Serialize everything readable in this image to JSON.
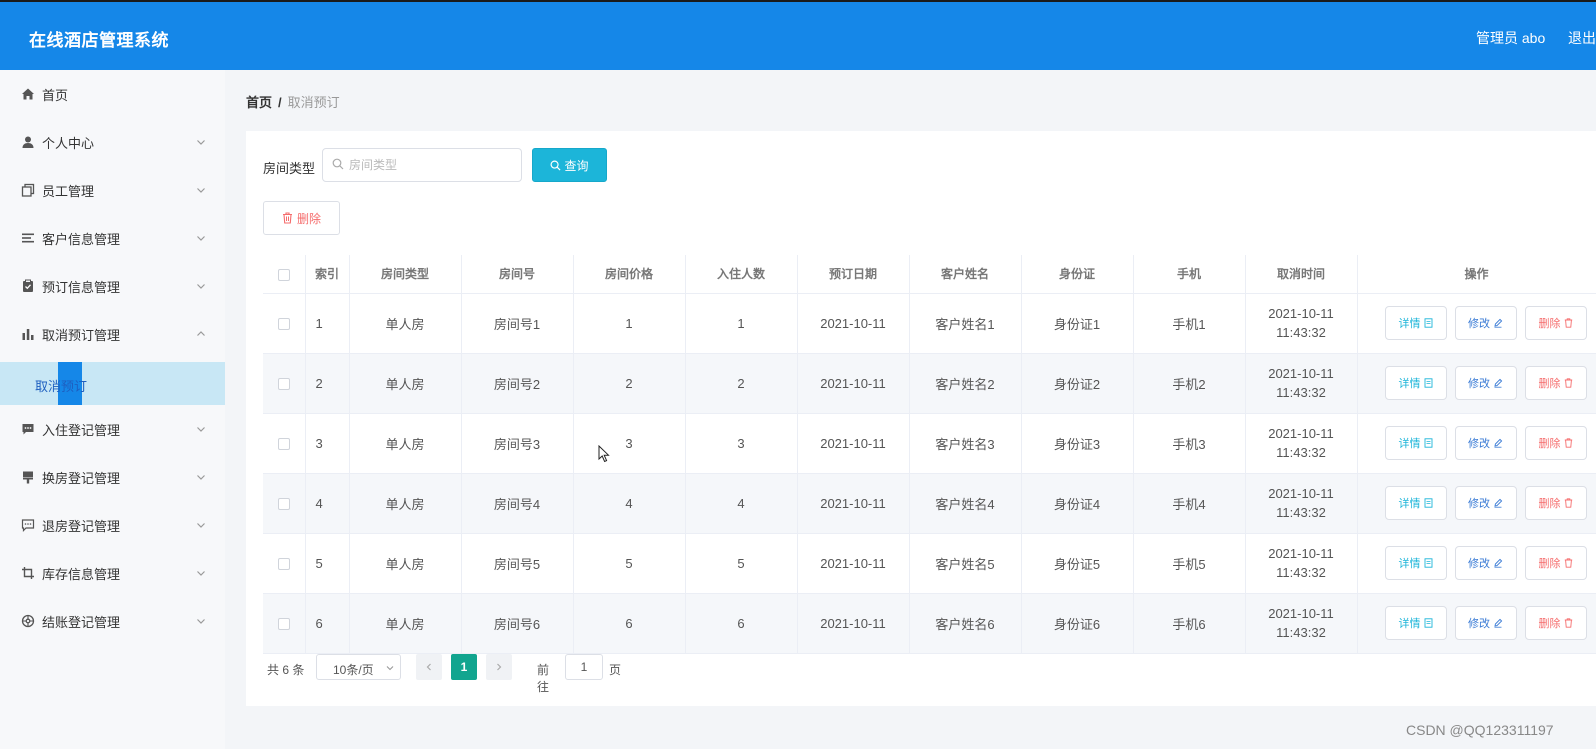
{
  "header": {
    "title": "在线酒店管理系统",
    "user": "管理员 abo",
    "logout": "退出"
  },
  "sidebar": {
    "items": [
      {
        "label": "首页",
        "icon": "home-icon"
      },
      {
        "label": "个人中心",
        "icon": "user-icon"
      },
      {
        "label": "员工管理",
        "icon": "copy-icon"
      },
      {
        "label": "客户信息管理",
        "icon": "list-icon"
      },
      {
        "label": "预订信息管理",
        "icon": "clipboard-icon"
      },
      {
        "label": "取消预订管理",
        "icon": "bar-chart-icon"
      },
      {
        "label": "入住登记管理",
        "icon": "message-icon"
      },
      {
        "label": "换房登记管理",
        "icon": "brush-icon"
      },
      {
        "label": "退房登记管理",
        "icon": "chat-icon"
      },
      {
        "label": "库存信息管理",
        "icon": "crop-icon"
      },
      {
        "label": "结账登记管理",
        "icon": "gear-icon"
      }
    ],
    "active_sub": "取消预订"
  },
  "breadcrumb": {
    "home": "首页",
    "separator": "/",
    "current": "取消预订"
  },
  "search": {
    "label": "房间类型",
    "placeholder": "房间类型",
    "value": "",
    "button": "查询"
  },
  "toolbar": {
    "delete": "删除"
  },
  "table": {
    "headers": [
      "索引",
      "房间类型",
      "房间号",
      "房间价格",
      "入住人数",
      "预订日期",
      "客户姓名",
      "身份证",
      "手机",
      "取消时间",
      "操作"
    ],
    "rows": [
      {
        "idx": "1",
        "type": "单人房",
        "room": "房间号1",
        "price": "1",
        "people": "1",
        "date": "2021-10-11",
        "name": "客户姓名1",
        "id": "身份证1",
        "phone": "手机1",
        "time": "2021-10-11 11:43:32"
      },
      {
        "idx": "2",
        "type": "单人房",
        "room": "房间号2",
        "price": "2",
        "people": "2",
        "date": "2021-10-11",
        "name": "客户姓名2",
        "id": "身份证2",
        "phone": "手机2",
        "time": "2021-10-11 11:43:32"
      },
      {
        "idx": "3",
        "type": "单人房",
        "room": "房间号3",
        "price": "3",
        "people": "3",
        "date": "2021-10-11",
        "name": "客户姓名3",
        "id": "身份证3",
        "phone": "手机3",
        "time": "2021-10-11 11:43:32"
      },
      {
        "idx": "4",
        "type": "单人房",
        "room": "房间号4",
        "price": "4",
        "people": "4",
        "date": "2021-10-11",
        "name": "客户姓名4",
        "id": "身份证4",
        "phone": "手机4",
        "time": "2021-10-11 11:43:32"
      },
      {
        "idx": "5",
        "type": "单人房",
        "room": "房间号5",
        "price": "5",
        "people": "5",
        "date": "2021-10-11",
        "name": "客户姓名5",
        "id": "身份证5",
        "phone": "手机5",
        "time": "2021-10-11 11:43:32"
      },
      {
        "idx": "6",
        "type": "单人房",
        "room": "房间号6",
        "price": "6",
        "people": "6",
        "date": "2021-10-11",
        "name": "客户姓名6",
        "id": "身份证6",
        "phone": "手机6",
        "time": "2021-10-11 11:43:32"
      }
    ],
    "actions": {
      "detail": "详情",
      "edit": "修改",
      "delete": "删除"
    }
  },
  "pagination": {
    "total": "共 6 条",
    "page_size": "10条/页",
    "current_page": "1",
    "goto_label": "前往",
    "goto_value": "1",
    "page_unit": "页"
  },
  "watermark": "CSDN @QQ123311197",
  "colors": {
    "header": "#1587e8",
    "query": "#1cb5d9",
    "current_page": "#12a58f",
    "danger": "#f56c6c"
  }
}
